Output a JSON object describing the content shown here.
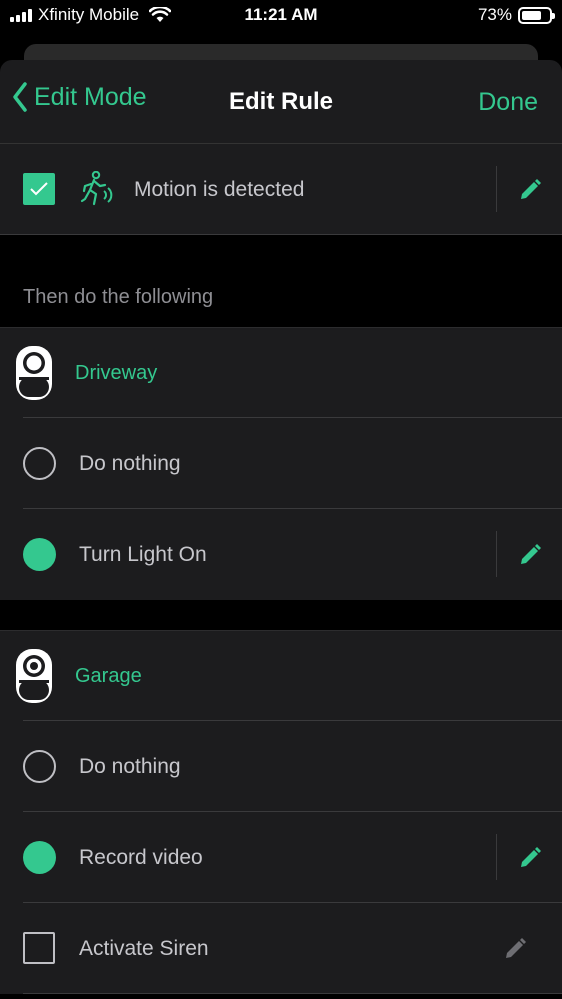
{
  "status_bar": {
    "carrier": "Xfinity Mobile",
    "time": "11:21 AM",
    "battery": "73%",
    "battery_level": 0.73
  },
  "nav": {
    "back_label": "Edit Mode",
    "title": "Edit Rule",
    "done_label": "Done"
  },
  "trigger": {
    "label": "Motion is detected",
    "checked": true
  },
  "section_header": "Then do the following",
  "devices": [
    {
      "name": "Driveway",
      "options": [
        {
          "label": "Do nothing",
          "control": "radio",
          "selected": false,
          "editable": false
        },
        {
          "label": "Turn Light On",
          "control": "radio",
          "selected": true,
          "editable": true
        }
      ]
    },
    {
      "name": "Garage",
      "options": [
        {
          "label": "Do nothing",
          "control": "radio",
          "selected": false,
          "editable": false
        },
        {
          "label": "Record video",
          "control": "radio",
          "selected": true,
          "editable": true
        },
        {
          "label": "Activate Siren",
          "control": "checkbox",
          "selected": false,
          "editable": true
        }
      ]
    }
  ],
  "colors": {
    "accent": "#34c88f",
    "background": "#000000",
    "cell": "#1c1c1e",
    "text_secondary": "#c7c7cc"
  }
}
